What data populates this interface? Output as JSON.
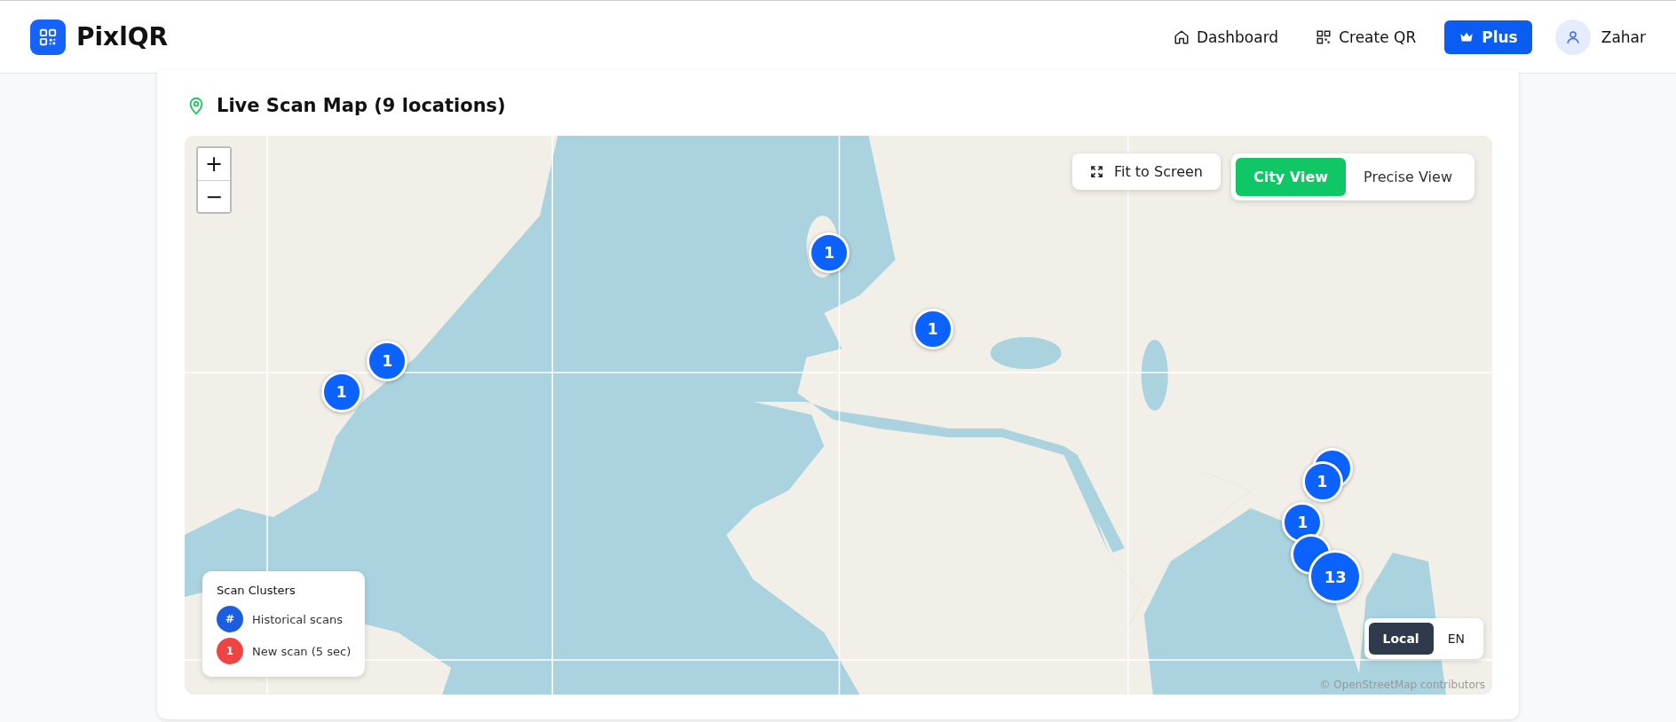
{
  "header": {
    "brand": "PixlQR",
    "nav": [
      {
        "kind": "home",
        "label": "Dashboard"
      },
      {
        "kind": "qr",
        "label": "Create QR"
      },
      {
        "kind": "plus",
        "label": "Plus"
      }
    ],
    "user": {
      "name": "Zahar"
    }
  },
  "card": {
    "title": "Live Scan Map (9 locations)",
    "map": {
      "zoom": [
        "+",
        "−"
      ],
      "fit_button": "Fit to Screen",
      "view_toggle": [
        {
          "label": "City View",
          "selected": true
        },
        {
          "label": "Precise View",
          "selected": false
        }
      ],
      "markers": [
        {
          "kind": "single",
          "label": "1"
        },
        {
          "kind": "single",
          "label": "1"
        },
        {
          "kind": "single",
          "label": "1"
        },
        {
          "kind": "single",
          "label": "1"
        },
        {
          "kind": "stack",
          "label": "1"
        },
        {
          "kind": "single",
          "label": "1"
        },
        {
          "kind": "stack",
          "label": "13"
        }
      ],
      "legend": {
        "title": "Scan Clusters",
        "items": [
          {
            "symbol": "#",
            "label": "Historical scans",
            "color": "#1d5ee0"
          },
          {
            "symbol": "1",
            "label": "New scan (5 sec)",
            "color": "#ef4444"
          }
        ]
      },
      "language_toggle": [
        {
          "label": "Local",
          "selected": true
        },
        {
          "label": "EN",
          "selected": false
        }
      ],
      "attribution": "© OpenStreetMap contributors"
    }
  }
}
